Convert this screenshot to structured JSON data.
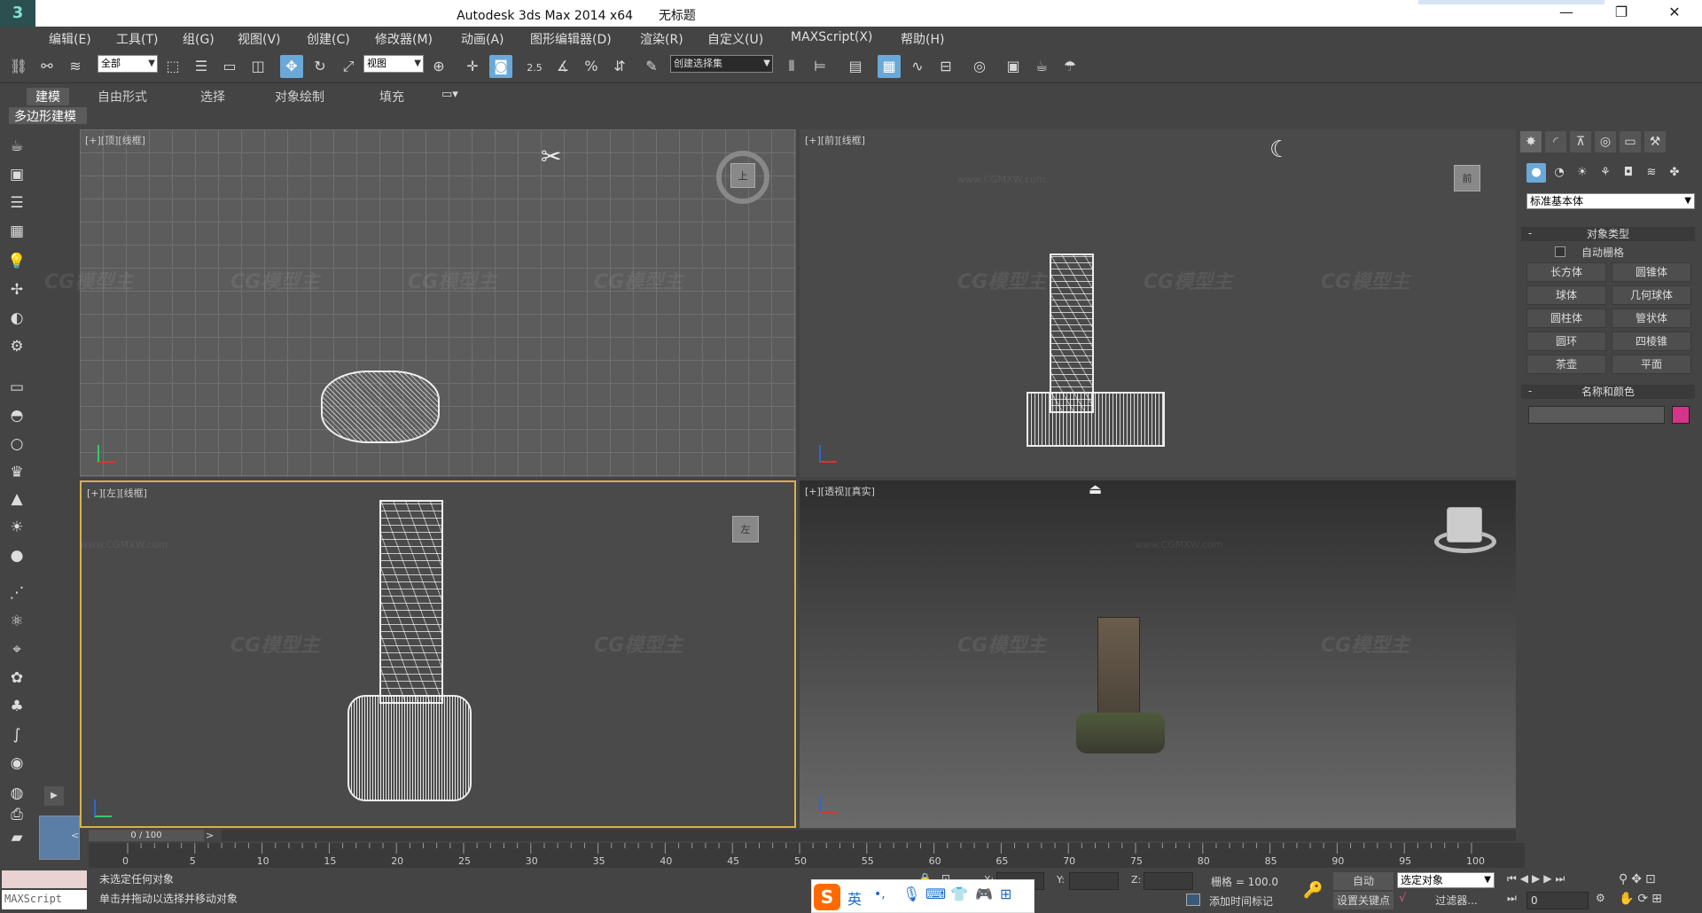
{
  "app": {
    "logo_glyph": "3",
    "title": "Autodesk 3ds Max  2014 x64",
    "filename": "无标题",
    "controls": [
      "—",
      "❐",
      "✕"
    ]
  },
  "menu": [
    "编辑(E)",
    "工具(T)",
    "组(G)",
    "视图(V)",
    "创建(C)",
    "修改器(M)",
    "动画(A)",
    "图形编辑器(D)",
    "渲染(R)",
    "自定义(U)",
    "MAXScript(X)",
    "帮助(H)"
  ],
  "toolbar": {
    "filter_select": "全部",
    "ref_coord_select": "视图",
    "selection_set": "创建选择集",
    "snap_label": "2.5",
    "angle_label": "%"
  },
  "ribbon": {
    "tabs": [
      "建模",
      "自由形式",
      "选择",
      "对象绘制",
      "填充"
    ],
    "active_tab": "建模",
    "sub_label": "多边形建模"
  },
  "viewports": {
    "top": {
      "label": "[+][顶][线框]",
      "cube_label": "上"
    },
    "front": {
      "label": "[+][前][线框]",
      "cube_label": "前"
    },
    "left": {
      "label": "[+][左][线框]",
      "cube_label": "左"
    },
    "persp": {
      "label": "[+][透视][真实]",
      "cube_label": ""
    }
  },
  "watermark": {
    "brand": "CG模型主",
    "site": "www.CGMXW.com"
  },
  "command_panel": {
    "category_select": "标准基本体",
    "object_type_header": "对象类型",
    "autogrid_label": "自动栅格",
    "buttons": [
      "长方体",
      "圆锥体",
      "球体",
      "几何球体",
      "圆柱体",
      "管状体",
      "圆环",
      "四棱锥",
      "茶壶",
      "平面"
    ],
    "name_color_header": "名称和颜色",
    "swatch_color": "#d6338a"
  },
  "timeline": {
    "frame_counter": "0 / 100",
    "ticks": [
      "0",
      "5",
      "10",
      "15",
      "20",
      "25",
      "30",
      "35",
      "40",
      "45",
      "50",
      "55",
      "60",
      "65",
      "70",
      "75",
      "80",
      "85",
      "90",
      "95",
      "100"
    ]
  },
  "status": {
    "maxscript_label": "MAXScript",
    "line1": "未选定任何对象",
    "line2": "单击并拖动以选择并移动对象",
    "x_label": "X:",
    "y_label": "Y:",
    "z_label": "Z:",
    "grid_label": "栅格 = 100.0",
    "add_time_tag": "添加时间标记",
    "auto_label": "自动",
    "set_key_label": "设置关键点",
    "selected_select": "选定对象",
    "filter_label": "过滤器...",
    "frame_value": "0"
  },
  "ime": {
    "lang": "英",
    "punct": "•,"
  },
  "colors": {
    "accent": "#6aa8d8",
    "active_viewport_border": "#d7b14a"
  }
}
